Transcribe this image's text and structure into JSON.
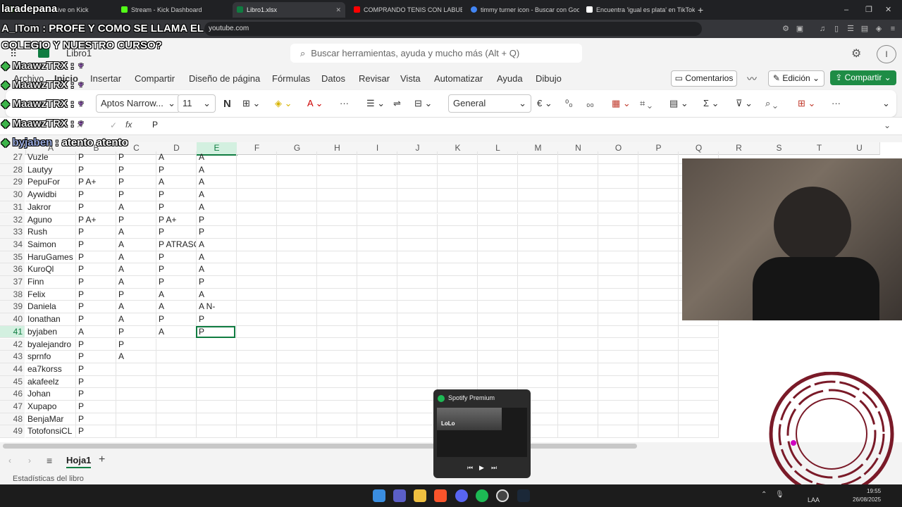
{
  "browser": {
    "tabs": [
      {
        "label": "laradepana - Live on Kick",
        "color": "#53fc18"
      },
      {
        "label": "Stream - Kick Dashboard",
        "color": "#53fc18"
      },
      {
        "label": "Libro1.xlsx",
        "color": "#107c41"
      },
      {
        "label": "COMPRANDO TENIS CON LABUBU",
        "color": "#ff0000"
      },
      {
        "label": "timmy turner icon - Buscar con Goog",
        "color": "#4285f4"
      },
      {
        "label": "Encuentra 'igual es plata' en TikTok |",
        "color": "#ffffff"
      }
    ],
    "new_tab": "+",
    "url": "youtube.com"
  },
  "excel": {
    "book_name": "Libro1",
    "search_placeholder": "Buscar herramientas, ayuda y mucho más (Alt + Q)",
    "menu": [
      "Archivo",
      "Inicio",
      "Insertar",
      "Compartir",
      "Diseño de página",
      "Fórmulas",
      "Datos",
      "Revisar",
      "Vista",
      "Automatizar",
      "Ayuda",
      "Dibujo"
    ],
    "comments_label": "Comentarios",
    "edit_label": "Edición",
    "share_label": "Compartir",
    "font_name": "Aptos Narrow...",
    "font_size": "11",
    "bold_label": "N",
    "number_format": "General",
    "currency_label": "€",
    "fx_label": "fx",
    "formula_value": "P",
    "columns": [
      "A",
      "B",
      "C",
      "D",
      "E",
      "F",
      "G",
      "H",
      "I",
      "J",
      "K",
      "L",
      "M",
      "N",
      "O",
      "P",
      "Q",
      "R",
      "S",
      "T",
      "U"
    ],
    "selected_column": "E",
    "selected_row": "41",
    "rows": [
      {
        "n": "27",
        "a": "Vuzle",
        "b": "P",
        "c": "P",
        "d": "A",
        "e": "A"
      },
      {
        "n": "28",
        "a": "Lautyy",
        "b": "P",
        "c": "P",
        "d": "P",
        "e": "A"
      },
      {
        "n": "29",
        "a": "PepuFor",
        "b": "P A+",
        "c": "P",
        "d": "A",
        "e": "A"
      },
      {
        "n": "30",
        "a": "Aywidbi",
        "b": "P",
        "c": "P",
        "d": "P",
        "e": "A"
      },
      {
        "n": "31",
        "a": "Jakror",
        "b": "P",
        "c": "A",
        "d": "P",
        "e": "A"
      },
      {
        "n": "32",
        "a": "Aguno",
        "b": "P A+",
        "c": "P",
        "d": "P A+",
        "e": "P"
      },
      {
        "n": "33",
        "a": "Rush",
        "b": "P",
        "c": "A",
        "d": "P",
        "e": "P"
      },
      {
        "n": "34",
        "a": "Saimon",
        "b": "P",
        "c": "A",
        "d": "P ATRASO",
        "e": "A"
      },
      {
        "n": "35",
        "a": "HaruGames",
        "b": "P",
        "c": "A",
        "d": "P",
        "e": "A"
      },
      {
        "n": "36",
        "a": "KuroQl",
        "b": "P",
        "c": "A",
        "d": "P",
        "e": "A"
      },
      {
        "n": "37",
        "a": "Finn",
        "b": "P",
        "c": "A",
        "d": "P",
        "e": "P"
      },
      {
        "n": "38",
        "a": "Felix",
        "b": "P",
        "c": "P",
        "d": "A",
        "e": "A"
      },
      {
        "n": "39",
        "a": "Daniela",
        "b": "P",
        "c": "A",
        "d": "A",
        "e": "A N-"
      },
      {
        "n": "40",
        "a": "Ionathan",
        "b": "P",
        "c": "A",
        "d": "P",
        "e": "P"
      },
      {
        "n": "41",
        "a": "byjaben",
        "b": "A",
        "c": "P",
        "d": "A",
        "e": "P"
      },
      {
        "n": "42",
        "a": "byalejandro",
        "b": "P",
        "c": "P",
        "d": "",
        "e": ""
      },
      {
        "n": "43",
        "a": "sprnfo",
        "b": "P",
        "c": "A",
        "d": "",
        "e": ""
      },
      {
        "n": "44",
        "a": "ea7korss",
        "b": "P",
        "c": "",
        "d": "",
        "e": ""
      },
      {
        "n": "45",
        "a": "akafeelz",
        "b": "P",
        "c": "",
        "d": "",
        "e": ""
      },
      {
        "n": "46",
        "a": "Johan",
        "b": "P",
        "c": "",
        "d": "",
        "e": ""
      },
      {
        "n": "47",
        "a": "Xupapo",
        "b": "P",
        "c": "",
        "d": "",
        "e": ""
      },
      {
        "n": "48",
        "a": "BenjaMar",
        "b": "P",
        "c": "",
        "d": "",
        "e": ""
      },
      {
        "n": "49",
        "a": "TotofonsiCL",
        "b": "P",
        "c": "",
        "d": "",
        "e": ""
      }
    ],
    "sheet_tab": "Hoja1",
    "add_sheet": "+",
    "status_text": "Estadísticas del libro"
  },
  "stream_overlay": {
    "channel": "laradepana",
    "chat": [
      {
        "user": "A_ITom",
        "message": ": PROFE Y COMO SE LLAMA EL"
      },
      {
        "user": "",
        "message": "COLEGIO Y NUESTRO CURSO?"
      },
      {
        "user": "MaawzTRX",
        "message": ":"
      },
      {
        "user": "MaawzTRX",
        "message": ":"
      },
      {
        "user": "MaawzTRX",
        "message": ":"
      },
      {
        "user": "MaawzTRX",
        "message": ":"
      },
      {
        "user": "byjaben",
        "message": ": atento atento"
      }
    ]
  },
  "spotify": {
    "title": "Spotify Premium",
    "album_label": "LoLo"
  },
  "taskbar": {
    "time": "19:55",
    "date": "26/08/2025",
    "lang": "LAA",
    "icons": [
      "windows-start",
      "teams",
      "file-explorer",
      "brave",
      "discord",
      "spotify",
      "obs",
      "steam"
    ]
  },
  "colors": {
    "excel_green": "#107c41",
    "kick_green": "#53fc18",
    "share_green": "#1e8c45"
  }
}
